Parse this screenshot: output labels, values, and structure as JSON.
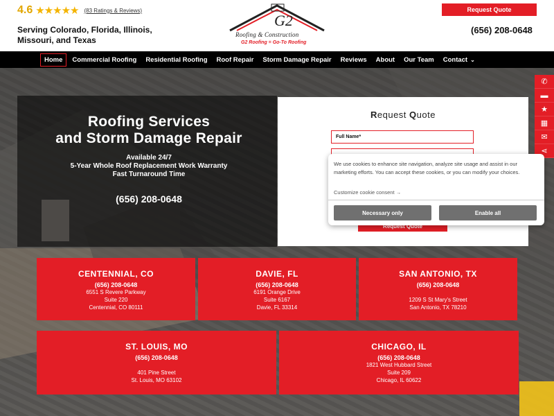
{
  "header": {
    "rating_value": "4.6",
    "stars": "★★★★★",
    "rating_count": "(83 Ratings & Reviews)",
    "serving": "Serving Colorado, Florida, Illinois, Missouri, and Texas",
    "request_button": "Request Quote",
    "phone": "(656) 208-0648",
    "logo_text": "Roofing & Construction",
    "logo_tagline": "G2 Roofing = Go-To Roofing",
    "logo_mark": "G2"
  },
  "nav": {
    "items": [
      "Home",
      "Commercial Roofing",
      "Residential Roofing",
      "Roof Repair",
      "Storm Damage Repair",
      "Reviews",
      "About",
      "Our Team",
      "Contact"
    ],
    "active": "Home"
  },
  "hero": {
    "title_line1": "Roofing Services",
    "title_line2": "and Storm Damage Repair",
    "line1": "Available 24/7",
    "line2": "5-Year Whole Roof Replacement Work Warranty",
    "line3": "Fast Turnaround Time",
    "phone": "(656) 208-0648"
  },
  "form": {
    "title_r": "R",
    "title_rest1": "equest ",
    "title_q": "Q",
    "title_rest2": "uote",
    "full_name_label": "Full Name*",
    "submit": "Request Quote"
  },
  "side_icons": [
    "phone-icon",
    "chat-icon",
    "star-icon",
    "calendar-icon",
    "email-icon",
    "share-icon"
  ],
  "cookie": {
    "text": "We use cookies to enhance site navigation, analyze site usage and assist in our marketing efforts. You can accept these cookies, or you can modify your choices.",
    "customize": "Customize cookie consent →",
    "necessary": "Necessary only",
    "enable": "Enable all"
  },
  "locations": [
    {
      "city": "CENTENNIAL, CO",
      "phone": "(656) 208-0648",
      "lines": [
        "6551 S Revere Parkway",
        "Suite 220",
        "Centennial, CO 80111"
      ]
    },
    {
      "city": "DAVIE, FL",
      "phone": "(656) 208-0648",
      "lines": [
        "6191 Orange Drive",
        "Suite 6167",
        "Davie, FL 33314"
      ]
    },
    {
      "city": "SAN ANTONIO, TX",
      "phone": "(656) 208-0648",
      "lines": [
        "",
        "1209 S St Mary's Street",
        "San Antonio, TX 78210"
      ]
    },
    {
      "city": "ST. LOUIS, MO",
      "phone": "(656) 208-0648",
      "lines": [
        "",
        "401 Pine Street",
        "St. Louis, MO 63102"
      ]
    },
    {
      "city": "CHICAGO, IL",
      "phone": "(656) 208-0648",
      "lines": [
        "1821 West Hubbard Street",
        "Suite 209",
        "Chicago, IL 60622"
      ]
    }
  ],
  "colors": {
    "brand_red": "#e31e26",
    "nav_bg": "#000000",
    "star": "#f4b400"
  }
}
